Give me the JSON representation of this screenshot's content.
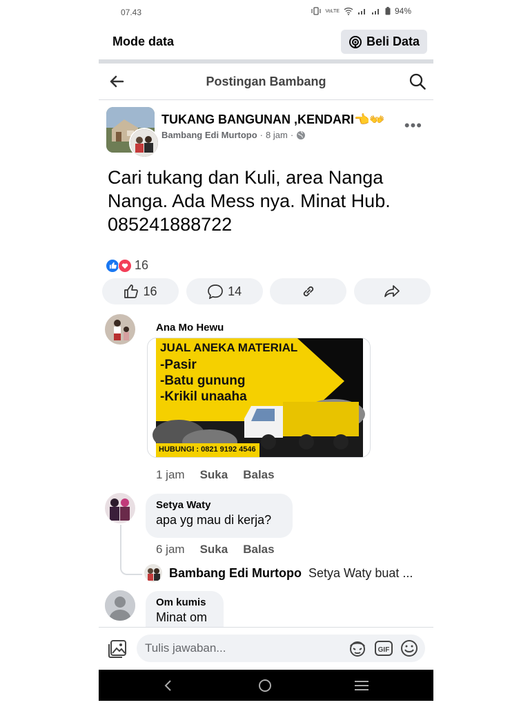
{
  "status_bar": {
    "time": "07.43",
    "network": "VoLTE",
    "battery": "94%"
  },
  "mode_bar": {
    "label": "Mode data",
    "buy_button": "Beli Data"
  },
  "header": {
    "title": "Postingan Bambang"
  },
  "post": {
    "group_name": "TUKANG BANGUNAN ,KENDARI👈👐",
    "author": "Bambang Edi Murtopo",
    "time": "8 jam",
    "text": "Cari tukang dan Kuli, area Nanga Nanga. Ada Mess nya. Minat Hub. 085241888722",
    "reaction_count": "16",
    "like_count": "16",
    "comment_count": "14"
  },
  "ad_image": {
    "headline": "JUAL ANEKA MATERIAL",
    "lines": [
      "-Pasir",
      "-Batu gunung",
      "-Krikil unaaha"
    ],
    "contact": "HUBUNGI : 0821 9192 4546"
  },
  "comments": [
    {
      "name": "Ana Mo Hewu",
      "time": "1 jam",
      "like": "Suka",
      "reply": "Balas"
    },
    {
      "name": "Setya Waty",
      "text": "apa yg mau  di kerja?",
      "time": "6 jam",
      "like": "Suka",
      "reply": "Balas",
      "reply_preview": {
        "name": "Bambang Edi Murtopo",
        "text": "Setya Waty buat ..."
      }
    },
    {
      "name": "Om kumis",
      "text": "Minat om"
    }
  ],
  "input": {
    "placeholder": "Tulis jawaban..."
  },
  "colors": {
    "facebook_blue": "#1877f2",
    "love_red": "#f33e58",
    "ad_yellow": "#f5d000"
  }
}
